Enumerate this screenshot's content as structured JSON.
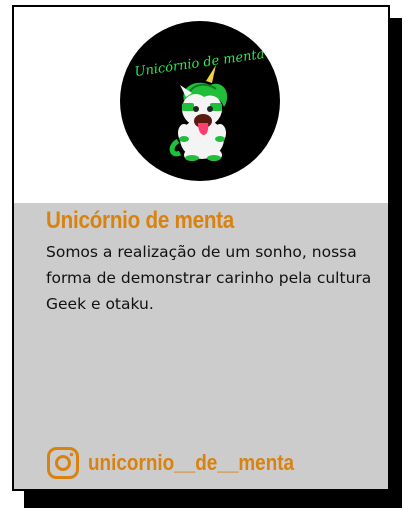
{
  "card": {
    "logo_text": "Unicórnio de menta",
    "title": "Unicórnio de menta",
    "description": "Somos a realização de um sonho, nossa forma de demonstrar carinho pela cultura Geek e otaku.",
    "social": {
      "icon": "instagram-icon",
      "handle": "unicornio__de__menta"
    }
  },
  "colors": {
    "accent": "#d9820f",
    "card_bottom_bg": "#cccccc",
    "logo_bg": "#000000",
    "logo_neon": "#2ee84a"
  }
}
